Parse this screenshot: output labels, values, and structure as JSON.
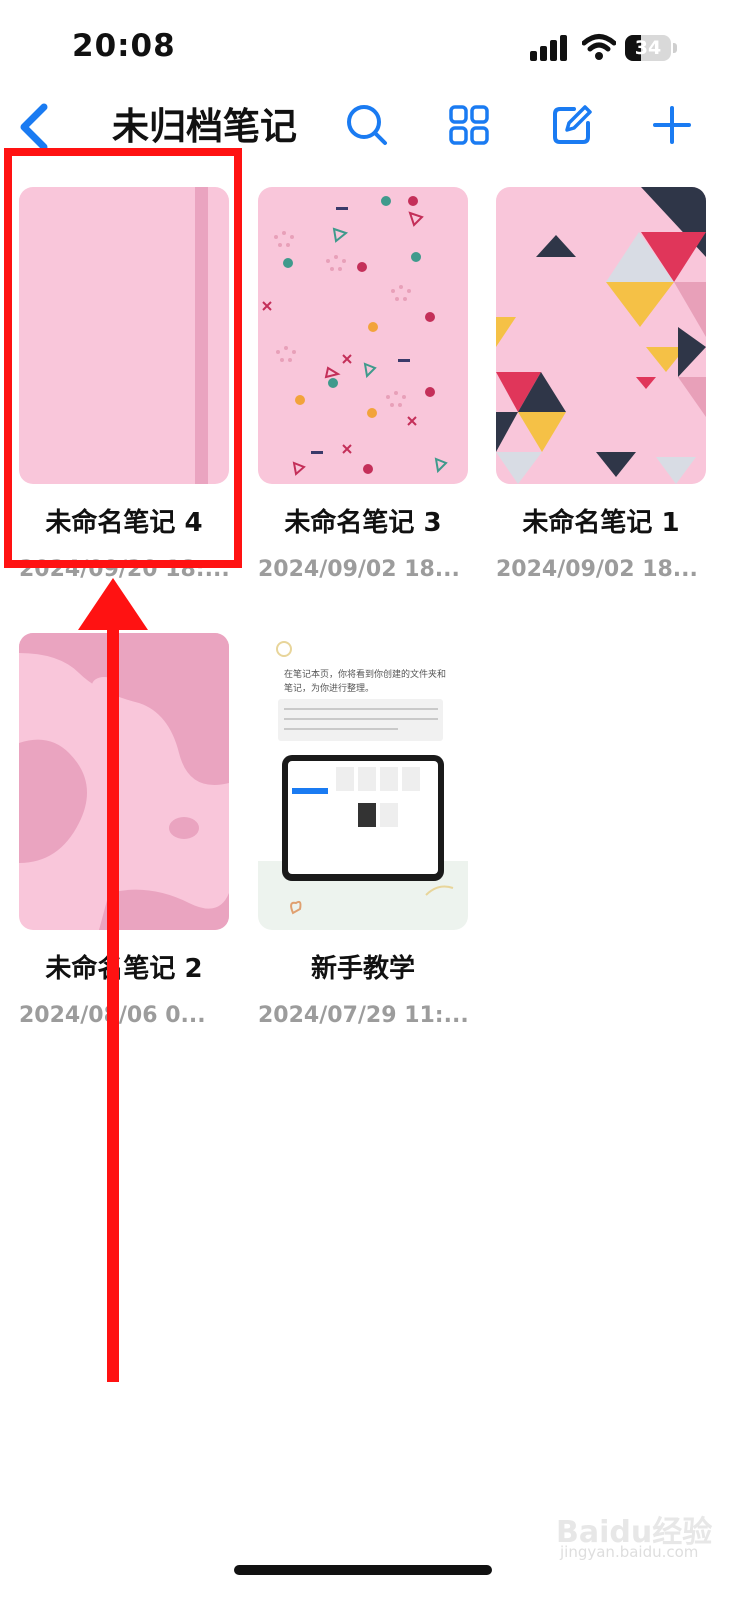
{
  "status_bar": {
    "time": "20:08",
    "battery": "34",
    "battery_level": 0.34
  },
  "nav": {
    "title": "未归档笔记"
  },
  "notebooks": [
    {
      "name": "未命名笔记 4",
      "date": "2024/09/20 18:..."
    },
    {
      "name": "未命名笔记 3",
      "date": "2024/09/02 18..."
    },
    {
      "name": "未命名笔记 1",
      "date": "2024/09/02 18..."
    },
    {
      "name": "未命名笔记 2",
      "date": "2024/08/06 0..."
    },
    {
      "name": "新手教学",
      "date": "2024/07/29 11:..."
    }
  ],
  "tutorial_cover": {
    "line1": "在笔记本页，你将看到你创建的文件夹和",
    "line2": "笔记，为你进行整理。"
  },
  "watermark": {
    "brand": "Baidu经验",
    "site": "jingyan.baidu.com"
  },
  "colors": {
    "accent": "#1a7bf2",
    "highlight": "#ff1212",
    "cover_pink": "#f9c6da",
    "cover_pink_dark": "#eaa4c0"
  }
}
